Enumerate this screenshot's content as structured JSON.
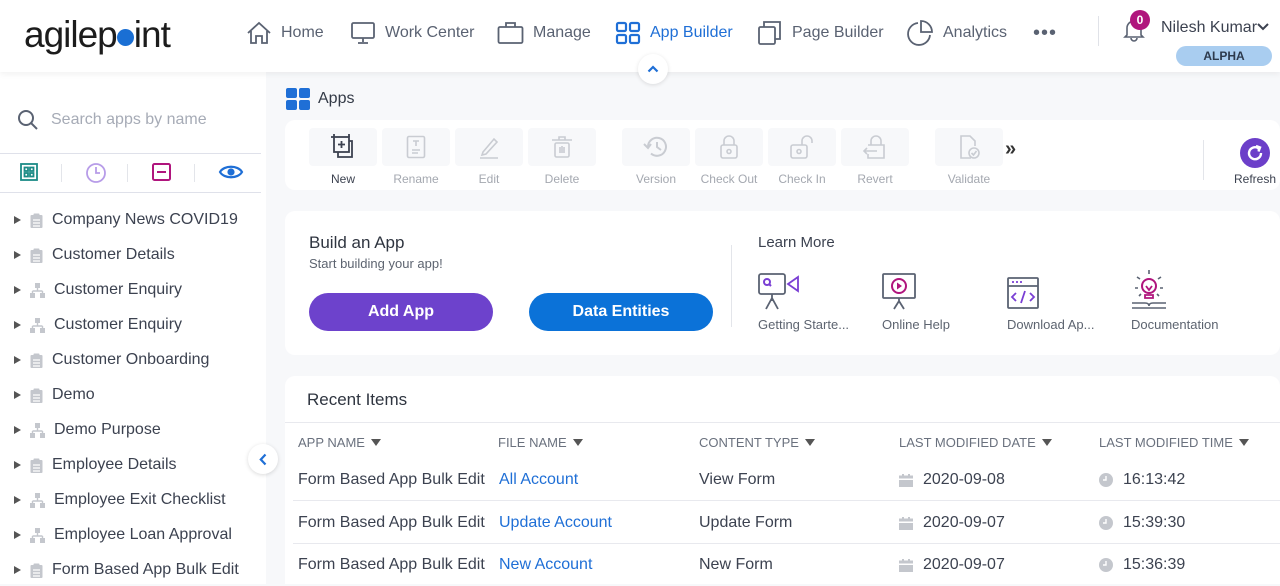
{
  "brand": {
    "logo_prefix": "agilep",
    "logo_suffix": "int"
  },
  "nav": {
    "items": [
      {
        "label": "Home",
        "icon": "home-icon"
      },
      {
        "label": "Work Center",
        "icon": "monitor-icon"
      },
      {
        "label": "Manage",
        "icon": "briefcase-icon"
      },
      {
        "label": "App Builder",
        "icon": "grid-icon",
        "active": true
      },
      {
        "label": "Page Builder",
        "icon": "pages-icon"
      },
      {
        "label": "Analytics",
        "icon": "pie-chart-icon"
      }
    ],
    "more_label": "•••",
    "notifications_count": "0",
    "user_name": "Nilesh Kumar",
    "environment": "ALPHA",
    "accent_color": "#1f6fd6"
  },
  "sidebar": {
    "search_placeholder": "Search apps by name",
    "filters": [
      "apps-filter-icon",
      "recent-filter-icon",
      "checked-out-filter-icon",
      "view-filter-icon"
    ],
    "items": [
      {
        "label": "Company News COVID19",
        "type": "form"
      },
      {
        "label": "Customer Details",
        "type": "form"
      },
      {
        "label": "Customer Enquiry",
        "type": "process"
      },
      {
        "label": "Customer Enquiry",
        "type": "process"
      },
      {
        "label": "Customer Onboarding",
        "type": "form"
      },
      {
        "label": "Demo",
        "type": "form"
      },
      {
        "label": "Demo Purpose",
        "type": "process"
      },
      {
        "label": "Employee Details",
        "type": "form"
      },
      {
        "label": "Employee Exit Checklist",
        "type": "process"
      },
      {
        "label": "Employee Loan Approval",
        "type": "process"
      },
      {
        "label": "Form Based App Bulk Edit",
        "type": "form"
      }
    ]
  },
  "main": {
    "title": "Apps",
    "toolbar": {
      "buttons": [
        {
          "label": "New",
          "enabled": true
        },
        {
          "label": "Rename",
          "enabled": false
        },
        {
          "label": "Edit",
          "enabled": false
        },
        {
          "label": "Delete",
          "enabled": false
        },
        {
          "label": "Version",
          "enabled": false
        },
        {
          "label": "Check Out",
          "enabled": false
        },
        {
          "label": "Check In",
          "enabled": false
        },
        {
          "label": "Revert",
          "enabled": false
        },
        {
          "label": "Validate",
          "enabled": false
        }
      ],
      "more_label": "»",
      "refresh_label": "Refresh"
    },
    "build": {
      "title": "Build an App",
      "subtitle": "Start building your app!",
      "add_app_label": "Add App",
      "data_entities_label": "Data Entities",
      "learn_more_title": "Learn More",
      "learn_more_items": [
        {
          "label": "Getting Starte...",
          "icon": "video-camera-icon"
        },
        {
          "label": "Online Help",
          "icon": "play-presentation-icon"
        },
        {
          "label": "Download Ap...",
          "icon": "code-window-icon"
        },
        {
          "label": "Documentation",
          "icon": "lightbulb-book-icon"
        }
      ]
    },
    "recent": {
      "title": "Recent Items",
      "columns": [
        "APP NAME",
        "FILE NAME",
        "CONTENT TYPE",
        "LAST MODIFIED DATE",
        "LAST MODIFIED TIME"
      ],
      "rows": [
        {
          "app": "Form Based App Bulk Edit",
          "file": "All Account",
          "type": "View Form",
          "date": "2020-09-08",
          "time": "16:13:42"
        },
        {
          "app": "Form Based App Bulk Edit",
          "file": "Update Account",
          "type": "Update Form",
          "date": "2020-09-07",
          "time": "15:39:30"
        },
        {
          "app": "Form Based App Bulk Edit",
          "file": "New Account",
          "type": "New Form",
          "date": "2020-09-07",
          "time": "15:36:39"
        }
      ]
    }
  }
}
